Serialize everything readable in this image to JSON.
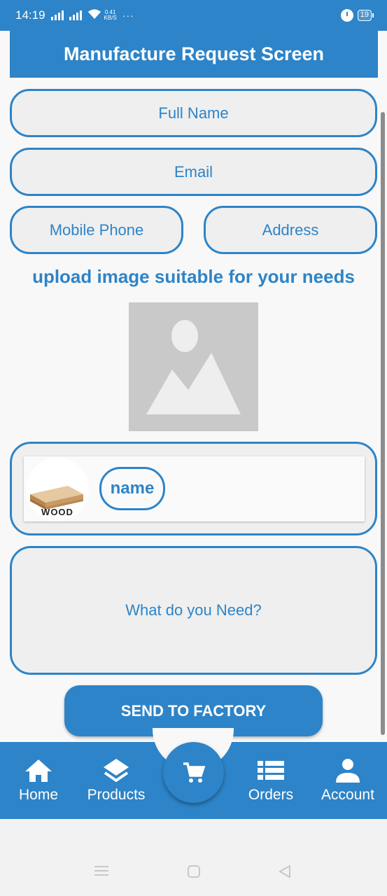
{
  "status_bar": {
    "time": "14:19",
    "speed_value": "0.41",
    "speed_unit": "KB/S",
    "more": "···",
    "battery": "19"
  },
  "header": {
    "title": "Manufacture Request Screen"
  },
  "form": {
    "full_name_placeholder": "Full Name",
    "email_placeholder": "Email",
    "mobile_placeholder": "Mobile Phone",
    "address_placeholder": "Address",
    "upload_label": "upload image suitable for your needs",
    "product": {
      "thumb_label": "WOOD",
      "name": "name"
    },
    "need_placeholder": "What do you Need?",
    "send_button": "SEND TO FACTORY"
  },
  "bottom_nav": {
    "items": [
      {
        "label": "Home",
        "icon": "home-icon"
      },
      {
        "label": "Products",
        "icon": "layers-icon"
      },
      {
        "label": "Orders",
        "icon": "list-icon"
      },
      {
        "label": "Account",
        "icon": "person-icon"
      }
    ],
    "center_icon": "cart-icon"
  },
  "colors": {
    "primary": "#2d84c8",
    "field_bg": "#efefef",
    "placeholder_img": "#c9c9c9"
  }
}
